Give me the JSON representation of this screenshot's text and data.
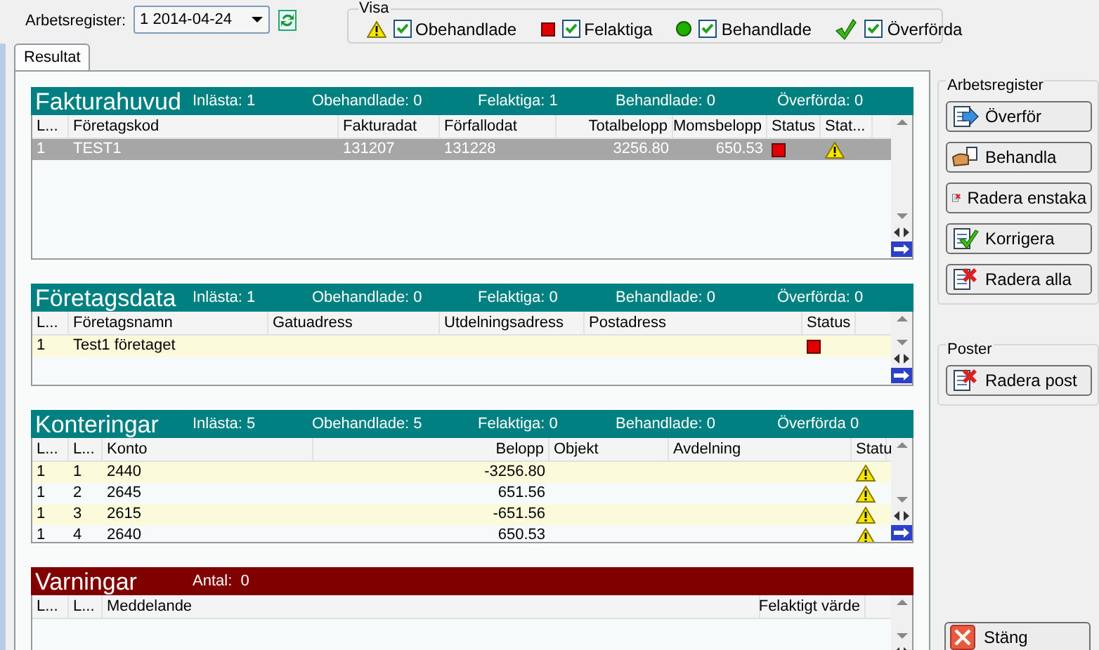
{
  "toolbar": {
    "label": "Arbetsregister:",
    "value": "1 2014-04-24"
  },
  "filter": {
    "legend": "Visa",
    "items": [
      {
        "kind": "warning",
        "label": "Obehandlade",
        "checked": true
      },
      {
        "kind": "error",
        "label": "Felaktiga",
        "checked": true
      },
      {
        "kind": "done",
        "label": "Behandlade",
        "checked": true
      },
      {
        "kind": "sent",
        "label": "Överförda",
        "checked": true
      }
    ]
  },
  "tabs": [
    {
      "label": "Resultat",
      "selected": true
    }
  ],
  "sections": [
    {
      "title": "Fakturahuvud",
      "color": "#008080",
      "stats": [
        "Inlästa: 1",
        "Obehandlade: 0",
        "Felaktiga: 1",
        "Behandlade: 0",
        "Överförda: 0"
      ],
      "columns": [
        "L...",
        "Företagskod",
        "Fakturadat",
        "Förfallodat",
        "Totalbelopp",
        "Momsbelopp",
        "Status",
        "Stat..."
      ],
      "rows": [
        {
          "selected": true,
          "cells": [
            "1",
            "TEST1",
            "131207",
            "131228",
            "3256.80",
            "650.53",
            {
              "kind": "error"
            },
            {
              "kind": "warning"
            }
          ]
        }
      ]
    },
    {
      "title": "Företagsdata",
      "color": "#008080",
      "stats": [
        "Inlästa: 1",
        "Obehandlade: 0",
        "Felaktiga: 0",
        "Behandlade: 0",
        "Överförda: 0"
      ],
      "columns": [
        "L...",
        "Företagsnamn",
        "Gatuadress",
        "Utdelningsadress",
        "Postadress",
        "Status"
      ],
      "rows": [
        {
          "selected": false,
          "cells": [
            "1",
            "Test1 företaget",
            null,
            null,
            null,
            {
              "kind": "error"
            }
          ]
        }
      ]
    },
    {
      "title": "Konteringar",
      "color": "#008080",
      "stats": [
        "Inlästa: 5",
        "Obehandlade: 5",
        "Felaktiga: 0",
        "Behandlade: 0",
        "Överförda 0"
      ],
      "columns": [
        "L...",
        "L...",
        "Konto",
        null,
        "Objekt",
        "Avdelning",
        "Statu"
      ],
      "belopp": "Belopp",
      "rows": [
        {
          "selected": false,
          "cells": [
            "1",
            "1",
            "2440",
            "-3256.80",
            null,
            null,
            {
              "kind": "warning"
            }
          ]
        },
        {
          "selected": false,
          "cells": [
            "1",
            "2",
            "2645",
            "651.56",
            null,
            null,
            {
              "kind": "warning"
            }
          ]
        },
        {
          "selected": false,
          "cells": [
            "1",
            "3",
            "2615",
            "-651.56",
            null,
            null,
            {
              "kind": "warning"
            }
          ]
        },
        {
          "selected": false,
          "cells": [
            "1",
            "4",
            "2640",
            "650.53",
            null,
            null,
            {
              "kind": "warning"
            }
          ]
        }
      ]
    },
    {
      "title": "Varningar",
      "color": "#800000",
      "stats": [
        "Antal:  0"
      ],
      "columns": [
        "L...",
        "L...",
        "Meddelande",
        "Felaktigt värde"
      ]
    }
  ],
  "side_groups": [
    {
      "title": "Arbetsregister",
      "buttons": [
        {
          "kind": "transfer",
          "label": "Överför"
        },
        {
          "kind": "process",
          "label": "Behandla"
        },
        {
          "kind": "delete",
          "label": "Radera enstaka"
        },
        {
          "kind": "correct",
          "label": "Korrigera"
        },
        {
          "kind": "delete",
          "label": "Radera alla"
        }
      ]
    },
    {
      "title": "Poster",
      "buttons": [
        {
          "kind": "delete",
          "label": "Radera post"
        }
      ]
    }
  ],
  "close_button": {
    "kind": "close",
    "label": "Stäng"
  }
}
